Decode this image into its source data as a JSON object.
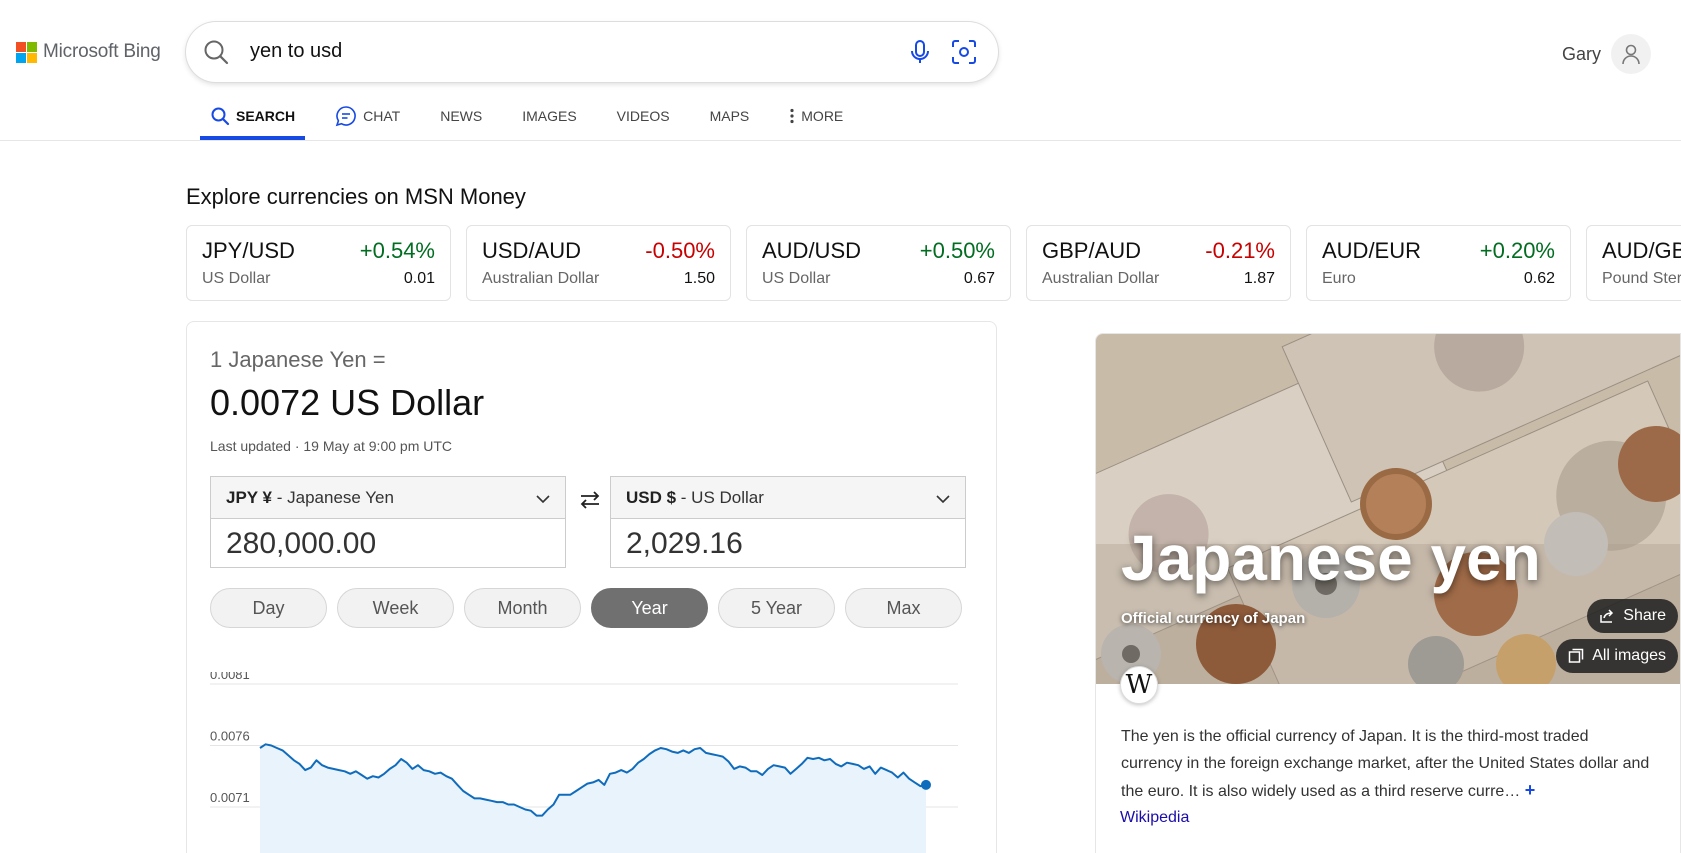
{
  "brand": {
    "name": "Microsoft Bing",
    "colors": [
      "#f25022",
      "#7fba00",
      "#00a4ef",
      "#ffb900"
    ]
  },
  "search": {
    "query": "yen to usd",
    "icon": "search-icon",
    "mic_icon": "microphone-icon",
    "visual_icon": "visual-search-icon"
  },
  "user": {
    "name": "Gary",
    "icon": "user-icon"
  },
  "nav": {
    "items": [
      {
        "label": "SEARCH",
        "icon": "search-icon",
        "active": true
      },
      {
        "label": "CHAT",
        "icon": "chat-icon",
        "active": false
      },
      {
        "label": "NEWS",
        "active": false
      },
      {
        "label": "IMAGES",
        "active": false
      },
      {
        "label": "VIDEOS",
        "active": false
      },
      {
        "label": "MAPS",
        "active": false
      },
      {
        "label": "MORE",
        "icon": "more-vertical-icon",
        "active": false
      }
    ]
  },
  "explore": {
    "title": "Explore currencies on MSN Money",
    "tickers": [
      {
        "pair": "JPY/USD",
        "change": "+0.54%",
        "name": "US Dollar",
        "value": "0.01",
        "direction": "up"
      },
      {
        "pair": "USD/AUD",
        "change": "-0.50%",
        "name": "Australian Dollar",
        "value": "1.50",
        "direction": "down"
      },
      {
        "pair": "AUD/USD",
        "change": "+0.50%",
        "name": "US Dollar",
        "value": "0.67",
        "direction": "up"
      },
      {
        "pair": "GBP/AUD",
        "change": "-0.21%",
        "name": "Australian Dollar",
        "value": "1.87",
        "direction": "down"
      },
      {
        "pair": "AUD/EUR",
        "change": "+0.20%",
        "name": "Euro",
        "value": "0.62",
        "direction": "up"
      },
      {
        "pair": "AUD/GBP",
        "change": "",
        "name": "Pound Sterling",
        "value": "",
        "direction": ""
      }
    ]
  },
  "converter": {
    "label": "1 Japanese Yen =",
    "result": "0.0072 US Dollar",
    "last_updated": "Last updated · 19 May at 9:00 pm UTC",
    "from": {
      "code": "JPY ¥",
      "name": " - Japanese Yen",
      "amount": "280,000.00"
    },
    "to": {
      "code": "USD $",
      "name": " - US Dollar",
      "amount": "2,029.16"
    },
    "swap_icon": "swap-icon",
    "periods": [
      "Day",
      "Week",
      "Month",
      "Year",
      "5 Year",
      "Max"
    ],
    "active_period": "Year"
  },
  "chart_data": {
    "type": "area",
    "title": "",
    "xlabel": "",
    "ylabel": "",
    "y_ticks": [
      "0.0081",
      "0.0076",
      "0.0071"
    ],
    "ylim": [
      0.0066,
      0.0081
    ],
    "grid": true,
    "color": "#0f6cbd",
    "series": [
      {
        "values": [
          0.00758,
          0.00761,
          0.0076,
          0.00758,
          0.00756,
          0.00752,
          0.00748,
          0.00745,
          0.0074,
          0.00742,
          0.00748,
          0.00744,
          0.00742,
          0.00741,
          0.0074,
          0.00739,
          0.00737,
          0.00739,
          0.00736,
          0.00733,
          0.00735,
          0.00734,
          0.00737,
          0.00741,
          0.00744,
          0.00749,
          0.00746,
          0.00741,
          0.00744,
          0.0074,
          0.00739,
          0.00737,
          0.00738,
          0.00735,
          0.00733,
          0.00728,
          0.00723,
          0.0072,
          0.00717,
          0.00717,
          0.00716,
          0.00715,
          0.00714,
          0.00714,
          0.00712,
          0.00712,
          0.0071,
          0.00708,
          0.00707,
          0.00703,
          0.00703,
          0.00708,
          0.00712,
          0.0072,
          0.0072,
          0.0072,
          0.00723,
          0.00726,
          0.00729,
          0.0073,
          0.00732,
          0.00728,
          0.00737,
          0.00738,
          0.0074,
          0.00738,
          0.00741,
          0.00746,
          0.00749,
          0.00753,
          0.00756,
          0.00758,
          0.00757,
          0.00755,
          0.00754,
          0.00756,
          0.00754,
          0.00757,
          0.00758,
          0.00754,
          0.00753,
          0.00752,
          0.00751,
          0.00747,
          0.00741,
          0.00743,
          0.00742,
          0.00739,
          0.00739,
          0.00736,
          0.00741,
          0.00744,
          0.00743,
          0.00742,
          0.00737,
          0.00741,
          0.00745,
          0.0075,
          0.00749,
          0.0075,
          0.00748,
          0.00749,
          0.00745,
          0.00743,
          0.00746,
          0.00745,
          0.00744,
          0.00741,
          0.00743,
          0.00737,
          0.00742,
          0.0074,
          0.00738,
          0.00734,
          0.00738,
          0.00733,
          0.0073,
          0.00727,
          0.00728
        ]
      }
    ]
  },
  "entity": {
    "title": "Japanese yen",
    "subtitle": "Official currency of Japan",
    "share_label": "Share",
    "all_images_label": "All images",
    "description": "The yen is the official currency of Japan. It is the third-most traded currency in the foreign exchange market, after the United States dollar and the euro. It is also widely used as a third reserve curre…",
    "more_symbol": "+",
    "source": "Wikipedia",
    "wiki_glyph": "W"
  }
}
